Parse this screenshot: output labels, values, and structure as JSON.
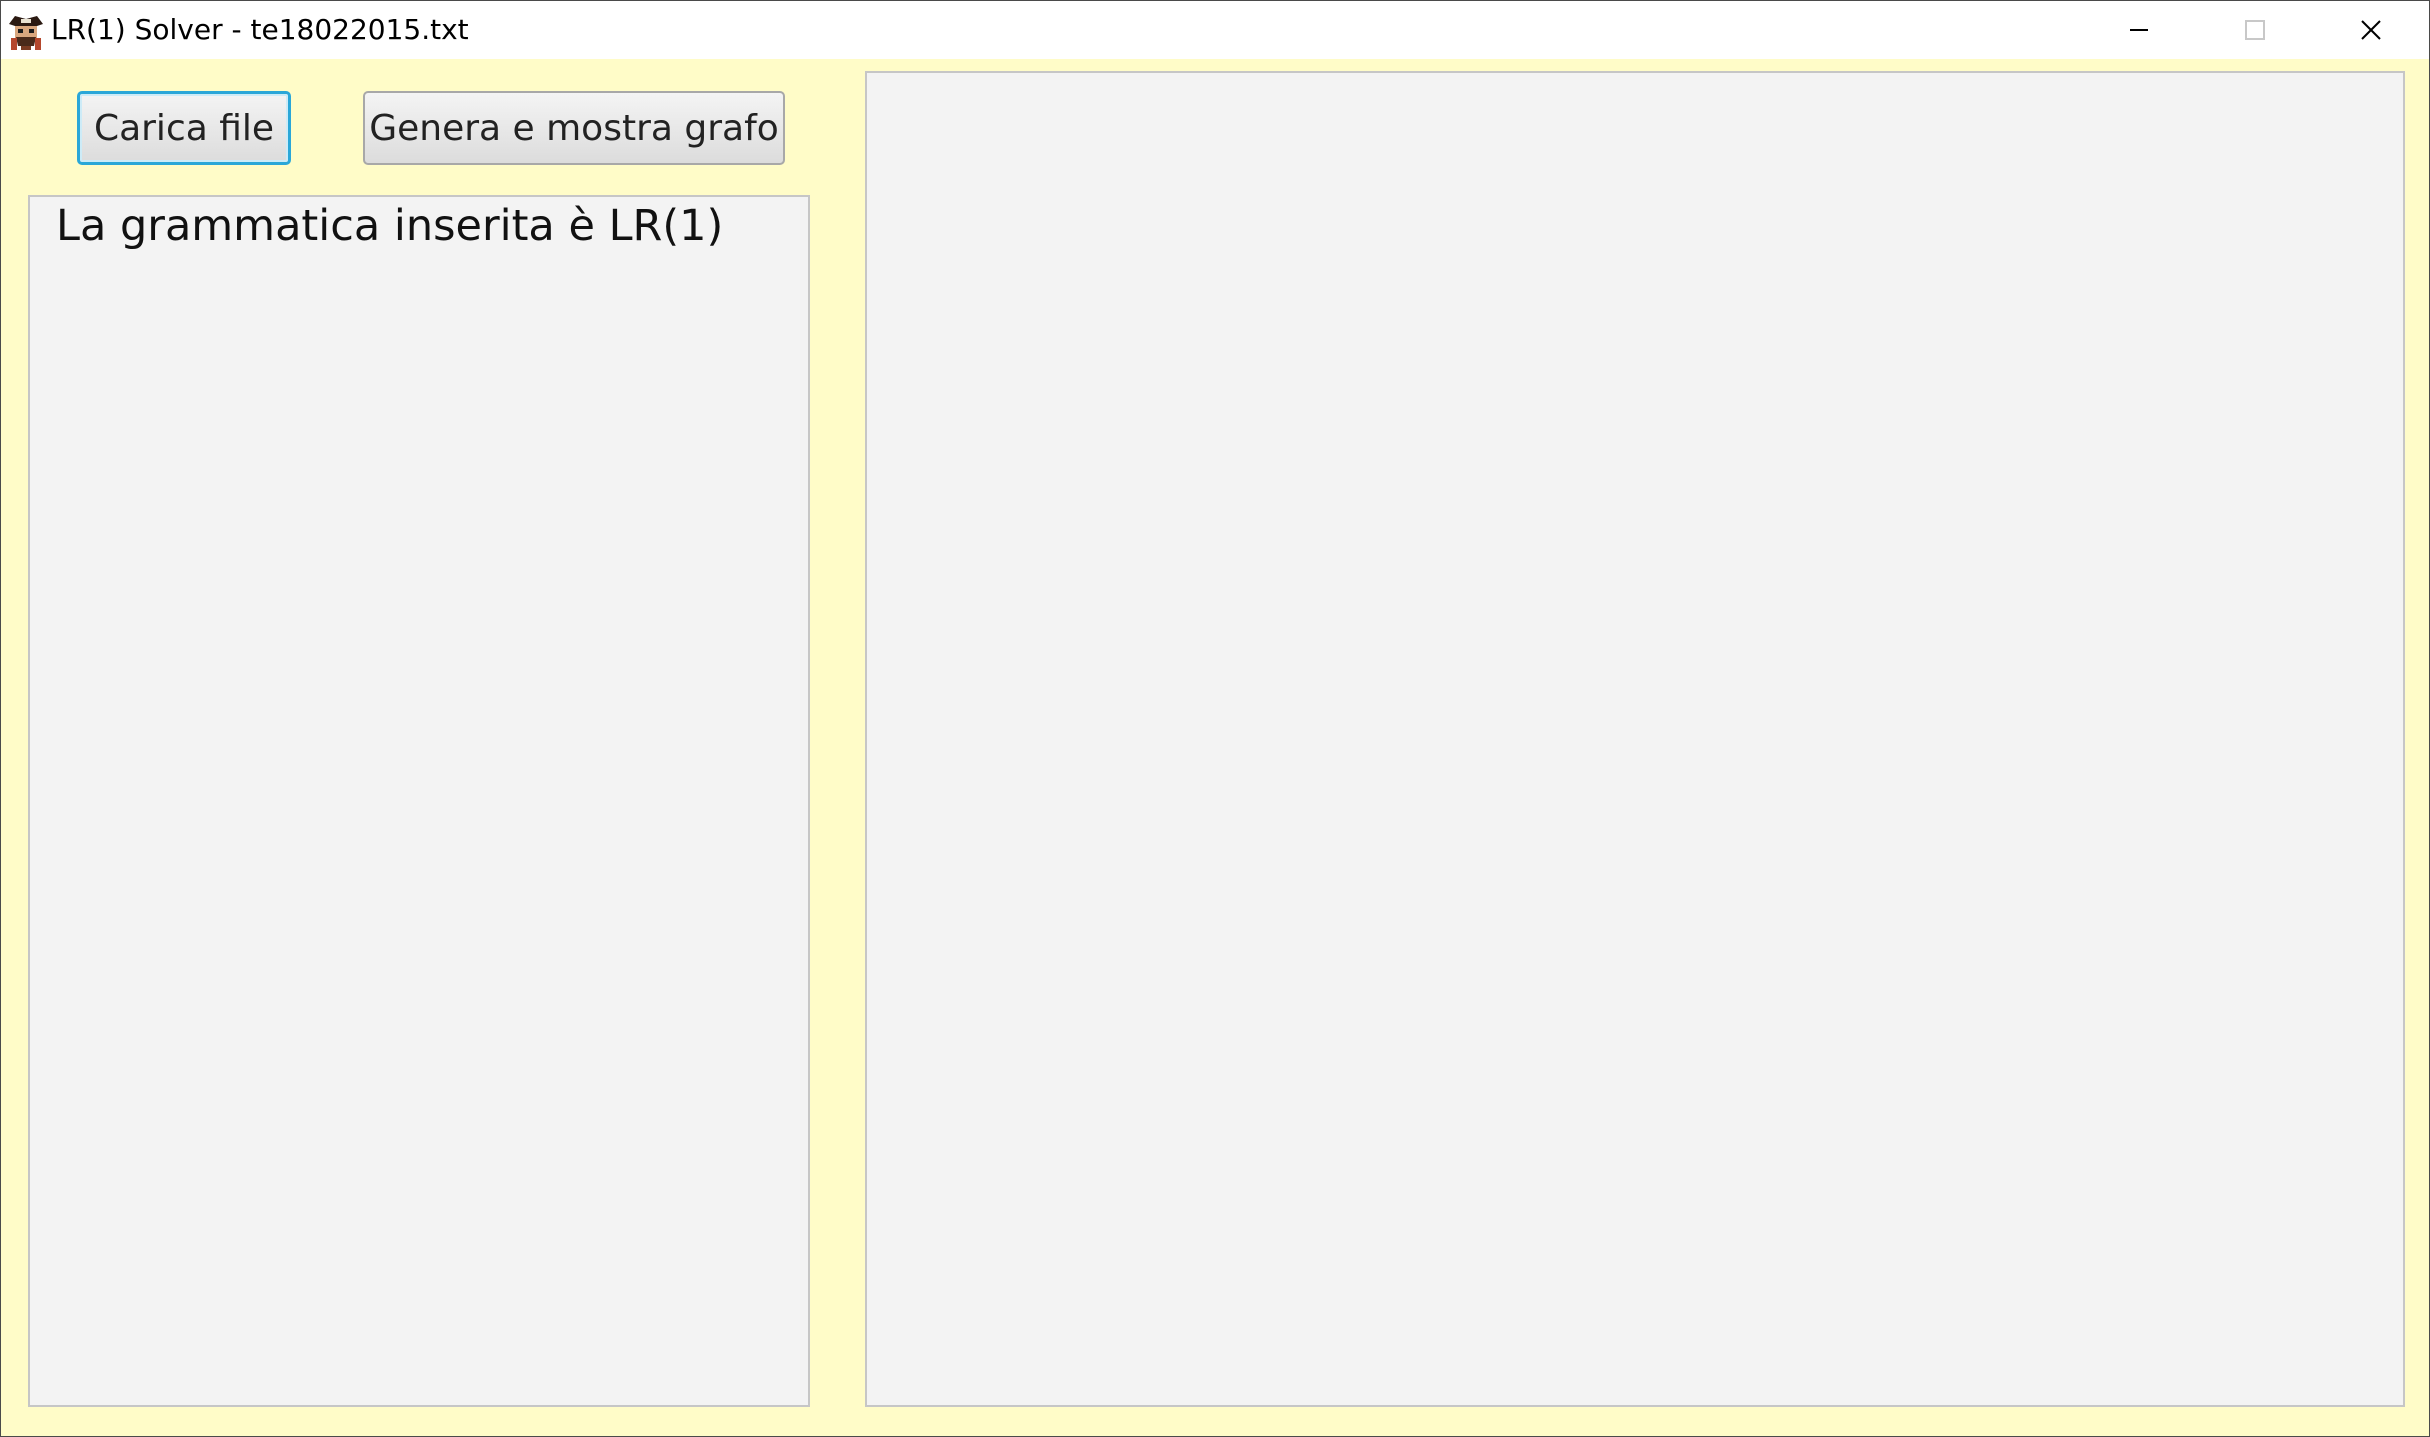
{
  "window": {
    "title": "LR(1) Solver - te18022015.txt",
    "icon": "pirate-app-icon",
    "controls": [
      "minimize-icon",
      "maximize-icon",
      "close-icon"
    ],
    "background_color": "#fffcc8"
  },
  "toolbar": {
    "load_label": "Carica file",
    "graph_label": "Genera e mostra grafo"
  },
  "left_panel": {
    "message": "La grammatica inserita è LR(1)"
  },
  "colors": {
    "focus_ring": "#2aa7d8",
    "panel_bg": "#f3f3f3",
    "panel_border": "#c6c6c6"
  }
}
